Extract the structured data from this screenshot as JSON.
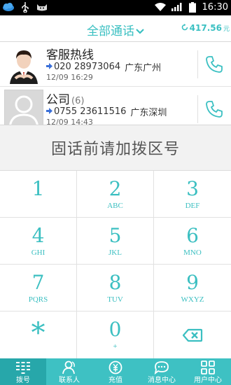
{
  "status_bar": {
    "time": "16:30"
  },
  "header": {
    "title": "全部通话",
    "balance": "417.56",
    "balance_unit": "元"
  },
  "calls": [
    {
      "name": "客服热线",
      "count": "",
      "number": "020 28973064",
      "location": "广东广州",
      "date": "12/09 16:29"
    },
    {
      "name": "公司",
      "count": "(6)",
      "number": "0755 23611516",
      "location": "广东深圳",
      "date": "12/09 14:43"
    }
  ],
  "dialpad": {
    "hint": "固话前请加拨区号",
    "keys": [
      {
        "digit": "1",
        "letters": ""
      },
      {
        "digit": "2",
        "letters": "ABC"
      },
      {
        "digit": "3",
        "letters": "DEF"
      },
      {
        "digit": "4",
        "letters": "GHI"
      },
      {
        "digit": "5",
        "letters": "JKL"
      },
      {
        "digit": "6",
        "letters": "MNO"
      },
      {
        "digit": "7",
        "letters": "PQRS"
      },
      {
        "digit": "8",
        "letters": "TUV"
      },
      {
        "digit": "9",
        "letters": "WXYZ"
      },
      {
        "digit": "*",
        "letters": ""
      },
      {
        "digit": "0",
        "letters": "+"
      }
    ]
  },
  "tabs": [
    {
      "label": "拨号",
      "icon": "dialpad-icon",
      "active": true
    },
    {
      "label": "联系人",
      "icon": "contacts-icon",
      "active": false
    },
    {
      "label": "充值",
      "icon": "recharge-icon",
      "active": false
    },
    {
      "label": "消息中心",
      "icon": "message-icon",
      "active": false
    },
    {
      "label": "用户中心",
      "icon": "user-center-icon",
      "active": false
    }
  ],
  "colors": {
    "accent": "#3bc0c2",
    "tab_bar": "#3ec1c3",
    "tab_active": "#27a7aa",
    "arrow": "#3a6fd8"
  }
}
